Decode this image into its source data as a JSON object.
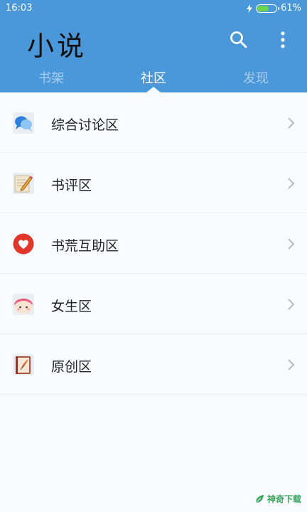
{
  "status_bar": {
    "time": "16:03",
    "battery": "61%",
    "battery_level": 0.61
  },
  "app_bar": {
    "title": "小说",
    "tabs": [
      {
        "label": "书架",
        "active": false
      },
      {
        "label": "社区",
        "active": true
      },
      {
        "label": "发现",
        "active": false
      }
    ]
  },
  "community_list": [
    {
      "label": "综合讨论区",
      "icon": "chat-bubbles-icon"
    },
    {
      "label": "书评区",
      "icon": "notepad-pencil-icon"
    },
    {
      "label": "书荒互助区",
      "icon": "heart-icon"
    },
    {
      "label": "女生区",
      "icon": "girl-face-icon"
    },
    {
      "label": "原创区",
      "icon": "book-quill-icon"
    }
  ],
  "watermark": {
    "text": "神奇下载"
  },
  "colors": {
    "primary": "#4a98d9",
    "background": "#f8fbff",
    "tab_inactive": "#a9cdee"
  }
}
